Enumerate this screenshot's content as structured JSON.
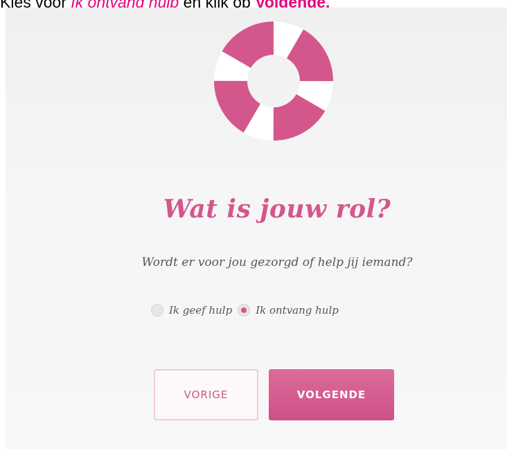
{
  "instruction": {
    "prefix": "Kies voor ",
    "option_text": "Ik ontvang hulp",
    "middle": " en klik op ",
    "button_text": "Volgende."
  },
  "page": {
    "title": "Wat is jouw rol?",
    "question": "Wordt er voor jou gezorgd of help jij iemand?"
  },
  "role_options": [
    {
      "label": "Ik geef hulp",
      "selected": false
    },
    {
      "label": "Ik ontvang hulp",
      "selected": true
    }
  ],
  "buttons": {
    "previous": "VORIGE",
    "next": "VOLGENDE"
  },
  "icons": {
    "hero": "lifebuoy-icon"
  },
  "colors": {
    "accent": "#d3578c",
    "instruction_highlight": "#e6007e",
    "panel_background": "#f3f3f3",
    "button_next": "#d65f92",
    "button_previous_border": "#f1cbdc"
  }
}
